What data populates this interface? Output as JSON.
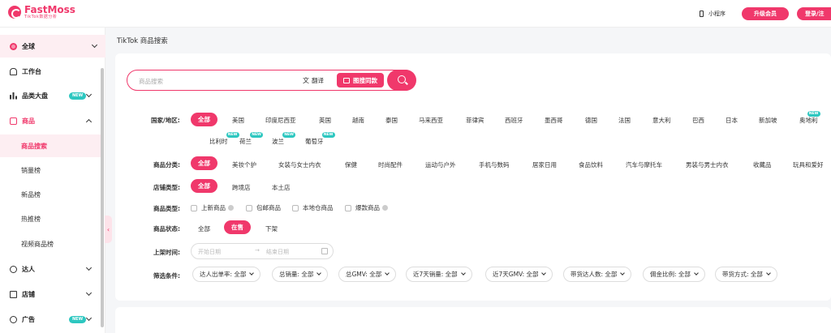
{
  "brand": {
    "name": "FastMoss",
    "tagline": "TikTok数据分析"
  },
  "header": {
    "mini_program": "小程序",
    "upgrade": "升级会员",
    "login": "登录/注"
  },
  "sidebar": {
    "global": "全球",
    "workbench": "工作台",
    "category": "品类大盘",
    "products": "商品",
    "product_search": "商品搜索",
    "sales_rank": "销量榜",
    "new_rank": "新品榜",
    "hot_rank": "热推榜",
    "video_rank": "视频商品榜",
    "creators": "达人",
    "stores": "店铺",
    "ads": "广告",
    "new_badge": "NEW"
  },
  "page": {
    "title": "TikTok 商品搜索"
  },
  "search": {
    "placeholder": "商品搜索",
    "translate": "翻译",
    "image_search": "图搜同款"
  },
  "filters": {
    "country_label": "国家/地区:",
    "countries": [
      "全部",
      "美国",
      "印度尼西亚",
      "英国",
      "越南",
      "泰国",
      "马来西亚",
      "菲律宾",
      "西班牙",
      "墨西哥",
      "德国",
      "法国",
      "意大利",
      "巴西",
      "日本",
      "新加坡",
      "奥地利",
      "比利时",
      "荷兰",
      "波兰",
      "葡萄牙"
    ],
    "category_label": "商品分类:",
    "categories": [
      "全部",
      "美妆个护",
      "女装与女士内衣",
      "保健",
      "时尚配件",
      "运动与户外",
      "手机与数码",
      "居家日用",
      "食品饮料",
      "汽车与摩托车",
      "男装与男士内衣",
      "收藏品",
      "玩具和爱好"
    ],
    "store_label": "店铺类型:",
    "store_types": [
      "全部",
      "跨境店",
      "本土店"
    ],
    "product_type_label": "商品类型:",
    "product_types": [
      "上新商品",
      "包邮商品",
      "本地仓商品",
      "爆款商品"
    ],
    "status_label": "商品状态:",
    "statuses": [
      "全部",
      "在售",
      "下架"
    ],
    "listing_label": "上架时间:",
    "date_start": "开始日期",
    "date_end": "结束日期",
    "date_arrow": "→",
    "conditions_label": "筛选条件:",
    "conditions": [
      "达人出单率: 全部",
      "总销量: 全部",
      "总GMV: 全部",
      "近7天销量: 全部",
      "近7天GMV: 全部",
      "带货达人数: 全部",
      "佣金比例: 全部",
      "带货方式: 全部"
    ]
  },
  "colors": {
    "accent": "#f0386b",
    "badge": "#2dc7c0"
  }
}
